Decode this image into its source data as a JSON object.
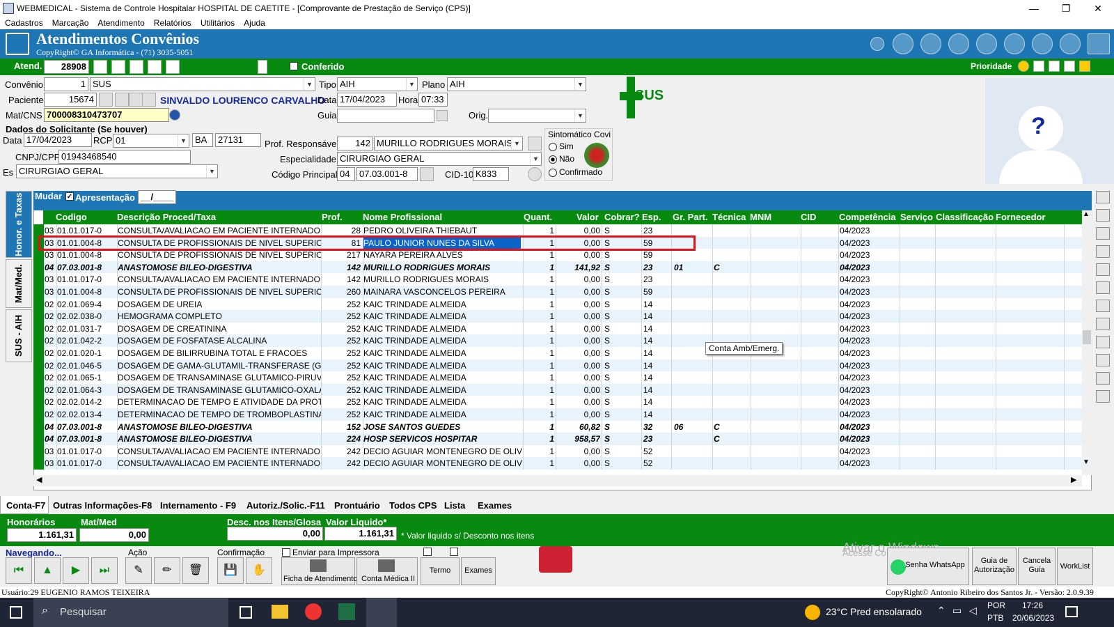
{
  "window": {
    "title": "WEBMEDICAL - Sistema de Controle Hospitalar HOSPITAL DE CAETITE - [Comprovante de Prestação de Serviço  (CPS)]",
    "min": "—",
    "max": "❐",
    "close": "✕"
  },
  "menu": [
    "Cadastros",
    "Marcação",
    "Atendimento",
    "Relatórios",
    "Utilitários",
    "Ajuda"
  ],
  "header": {
    "title": "Atendimentos Convênios",
    "subtitle": "CopyRight© GA Informática - (71) 3035-5051"
  },
  "atend": {
    "label": "Atend.",
    "value": "28908",
    "conferido": "Conferido",
    "prioridade": "Prioridade"
  },
  "form": {
    "convenio_label": "Convênio",
    "convenio_code": "1",
    "convenio_name": "SUS",
    "tipo_label": "Tipo",
    "tipo": "AIH",
    "plano_label": "Plano",
    "plano": "AIH",
    "paciente_label": "Paciente",
    "paciente_code": "15674",
    "paciente_name": "SINVALDO LOURENCO CARVALHO",
    "data_label": "Data",
    "data": "17/04/2023",
    "hora_label": "Hora",
    "hora": "07:33",
    "matcns_label": "Mat/CNS",
    "matcns": "700008310473707",
    "guia_label": "Guia",
    "guia": "",
    "orig_label": "Orig.",
    "orig": "",
    "solicitante_title": "Dados do Solicitante (Se houver)",
    "sol_data_label": "Data",
    "sol_data": "17/04/2023",
    "rcp_label": "RCP",
    "rcp": "01",
    "uf": "BA",
    "crm": "27131",
    "cnpj_label": "CNPJ/CPF",
    "cnpj": "01943468540",
    "es_label": "Es",
    "es": "CIRURGIAO GERAL",
    "prof_label": "Prof. Responsável",
    "prof_code": "142",
    "prof_name": "MURILLO RODRIGUES MORAIS",
    "esp_label": "Especialidade",
    "esp": "CIRURGIAO GERAL",
    "codprinc_label": "Código Principal",
    "codprinc_grp": "04",
    "codprinc": "07.03.001-8",
    "cid_label": "CID-10",
    "cid": "K833",
    "covid_title": "Sintomático Covi",
    "covid_sim": "Sim",
    "covid_nao": "Não",
    "covid_conf": "Confirmado"
  },
  "sus_logo": "SUS",
  "sidetabs": [
    "Honor. e Taxas",
    "Mat/Med.",
    "SUS - AIH"
  ],
  "grid": {
    "mudar": "Mudar",
    "apresentacao": "Apresentação",
    "apres_value": "__/____",
    "columns": [
      "Codigo",
      "Descrição Proced/Taxa",
      "Prof.",
      "Nome Profissional",
      "Quant.",
      "Valor",
      "Cobrar?",
      "Esp.",
      "Gr. Part.",
      "Técnica",
      "MNM",
      "CID",
      "Competência",
      "Serviço",
      "Classificação",
      "Fornecedor"
    ],
    "rows": [
      {
        "g": "03",
        "cod": "01.01.017-0",
        "desc": "CONSULTA/AVALIACAO EM PACIENTE INTERNADO",
        "prof": "28",
        "nome": "PEDRO OLIVEIRA THIEBAUT",
        "q": "1",
        "val": "0,00",
        "cob": "S",
        "esp": "23",
        "gr": "",
        "tec": "",
        "comp": "04/2023",
        "b": false
      },
      {
        "g": "03",
        "cod": "01.01.004-8",
        "desc": "CONSULTA DE PROFISSIONAIS DE NIVEL SUPERIOR",
        "prof": "81",
        "nome": "PAULO JUNIOR NUNES DA SILVA",
        "q": "1",
        "val": "0,00",
        "cob": "S",
        "esp": "59",
        "gr": "",
        "tec": "",
        "comp": "04/2023",
        "b": false,
        "sel": true
      },
      {
        "g": "03",
        "cod": "01.01.004-8",
        "desc": "CONSULTA DE PROFISSIONAIS DE NIVEL SUPERIOR",
        "prof": "217",
        "nome": "NAYARA PEREIRA ALVES",
        "q": "1",
        "val": "0,00",
        "cob": "S",
        "esp": "59",
        "gr": "",
        "tec": "",
        "comp": "04/2023",
        "b": false
      },
      {
        "g": "04",
        "cod": "07.03.001-8",
        "desc": "ANASTOMOSE BILEO-DIGESTIVA",
        "prof": "142",
        "nome": "MURILLO RODRIGUES MORAIS",
        "q": "1",
        "val": "141,92",
        "cob": "S",
        "esp": "23",
        "gr": "01",
        "tec": "C",
        "comp": "04/2023",
        "b": true
      },
      {
        "g": "03",
        "cod": "01.01.017-0",
        "desc": "CONSULTA/AVALIACAO EM PACIENTE INTERNADO",
        "prof": "142",
        "nome": "MURILLO RODRIGUES MORAIS",
        "q": "1",
        "val": "0,00",
        "cob": "S",
        "esp": "23",
        "gr": "",
        "tec": "",
        "comp": "04/2023",
        "b": false
      },
      {
        "g": "03",
        "cod": "01.01.004-8",
        "desc": "CONSULTA DE PROFISSIONAIS DE NIVEL SUPERIOR",
        "prof": "260",
        "nome": "MAINARA VASCONCELOS PEREIRA",
        "q": "1",
        "val": "0,00",
        "cob": "S",
        "esp": "59",
        "gr": "",
        "tec": "",
        "comp": "04/2023",
        "b": false
      },
      {
        "g": "02",
        "cod": "02.01.069-4",
        "desc": "DOSAGEM DE UREIA",
        "prof": "252",
        "nome": "KAIC TRINDADE ALMEIDA",
        "q": "1",
        "val": "0,00",
        "cob": "S",
        "esp": "14",
        "gr": "",
        "tec": "",
        "comp": "04/2023",
        "b": false
      },
      {
        "g": "02",
        "cod": "02.02.038-0",
        "desc": "HEMOGRAMA COMPLETO",
        "prof": "252",
        "nome": "KAIC TRINDADE ALMEIDA",
        "q": "1",
        "val": "0,00",
        "cob": "S",
        "esp": "14",
        "gr": "",
        "tec": "",
        "comp": "04/2023",
        "b": false
      },
      {
        "g": "02",
        "cod": "02.01.031-7",
        "desc": "DOSAGEM DE CREATININA",
        "prof": "252",
        "nome": "KAIC TRINDADE ALMEIDA",
        "q": "1",
        "val": "0,00",
        "cob": "S",
        "esp": "14",
        "gr": "",
        "tec": "",
        "comp": "04/2023",
        "b": false
      },
      {
        "g": "02",
        "cod": "02.01.042-2",
        "desc": "DOSAGEM DE FOSFATASE ALCALINA",
        "prof": "252",
        "nome": "KAIC TRINDADE ALMEIDA",
        "q": "1",
        "val": "0,00",
        "cob": "S",
        "esp": "14",
        "gr": "",
        "tec": "",
        "comp": "04/2023",
        "b": false
      },
      {
        "g": "02",
        "cod": "02.01.020-1",
        "desc": "DOSAGEM DE BILIRRUBINA TOTAL E FRACOES",
        "prof": "252",
        "nome": "KAIC TRINDADE ALMEIDA",
        "q": "1",
        "val": "0,00",
        "cob": "S",
        "esp": "14",
        "gr": "",
        "tec": "",
        "comp": "04/2023",
        "b": false
      },
      {
        "g": "02",
        "cod": "02.01.046-5",
        "desc": "DOSAGEM DE GAMA-GLUTAMIL-TRANSFERASE (GAM",
        "prof": "252",
        "nome": "KAIC TRINDADE ALMEIDA",
        "q": "1",
        "val": "0,00",
        "cob": "S",
        "esp": "14",
        "gr": "",
        "tec": "",
        "comp": "04/2023",
        "b": false
      },
      {
        "g": "02",
        "cod": "02.01.065-1",
        "desc": "DOSAGEM DE TRANSAMINASE GLUTAMICO-PIRUVIC",
        "prof": "252",
        "nome": "KAIC TRINDADE ALMEIDA",
        "q": "1",
        "val": "0,00",
        "cob": "S",
        "esp": "14",
        "gr": "",
        "tec": "",
        "comp": "04/2023",
        "b": false
      },
      {
        "g": "02",
        "cod": "02.01.064-3",
        "desc": "DOSAGEM DE TRANSAMINASE GLUTAMICO-OXALACI",
        "prof": "252",
        "nome": "KAIC TRINDADE ALMEIDA",
        "q": "1",
        "val": "0,00",
        "cob": "S",
        "esp": "14",
        "gr": "",
        "tec": "",
        "comp": "04/2023",
        "b": false
      },
      {
        "g": "02",
        "cod": "02.02.014-2",
        "desc": "DETERMINACAO DE TEMPO E ATIVIDADE DA PROTR",
        "prof": "252",
        "nome": "KAIC TRINDADE ALMEIDA",
        "q": "1",
        "val": "0,00",
        "cob": "S",
        "esp": "14",
        "gr": "",
        "tec": "",
        "comp": "04/2023",
        "b": false
      },
      {
        "g": "02",
        "cod": "02.02.013-4",
        "desc": "DETERMINACAO DE TEMPO DE TROMBOPLASTINA F",
        "prof": "252",
        "nome": "KAIC TRINDADE ALMEIDA",
        "q": "1",
        "val": "0,00",
        "cob": "S",
        "esp": "14",
        "gr": "",
        "tec": "",
        "comp": "04/2023",
        "b": false
      },
      {
        "g": "04",
        "cod": "07.03.001-8",
        "desc": "ANASTOMOSE BILEO-DIGESTIVA",
        "prof": "152",
        "nome": "JOSE SANTOS GUEDES",
        "q": "1",
        "val": "60,82",
        "cob": "S",
        "esp": "32",
        "gr": "06",
        "tec": "C",
        "comp": "04/2023",
        "b": true
      },
      {
        "g": "04",
        "cod": "07.03.001-8",
        "desc": "ANASTOMOSE BILEO-DIGESTIVA",
        "prof": "224",
        "nome": "HOSP SERVICOS HOSPITAR",
        "q": "1",
        "val": "958,57",
        "cob": "S",
        "esp": "23",
        "gr": "",
        "tec": "C",
        "comp": "04/2023",
        "b": true
      },
      {
        "g": "03",
        "cod": "01.01.017-0",
        "desc": "CONSULTA/AVALIACAO EM PACIENTE INTERNADO",
        "prof": "242",
        "nome": "DECIO AGUIAR MONTENEGRO DE OLIVE",
        "q": "1",
        "val": "0,00",
        "cob": "S",
        "esp": "52",
        "gr": "",
        "tec": "",
        "comp": "04/2023",
        "b": false
      },
      {
        "g": "03",
        "cod": "01.01.017-0",
        "desc": "CONSULTA/AVALIACAO EM PACIENTE INTERNADO",
        "prof": "242",
        "nome": "DECIO AGUIAR MONTENEGRO DE OLIVE",
        "q": "1",
        "val": "0,00",
        "cob": "S",
        "esp": "52",
        "gr": "",
        "tec": "",
        "comp": "04/2023",
        "b": false
      }
    ]
  },
  "tooltip": "Conta Amb/Emerg.",
  "tabs": [
    "Conta-F7",
    "Outras Informações-F8",
    "Internamento - F9",
    "Autoriz./Solic.-F11",
    "Prontuário",
    "Todos CPS",
    "Lista",
    "Exames"
  ],
  "totals": {
    "hon_label": "Honorários",
    "hon": "1.161,31",
    "mat_label": "Mat/Med",
    "mat": "0,00",
    "desc_label": "Desc. nos Itens/Glosa",
    "desc": "0,00",
    "liq_label": "Valor Liquido*",
    "liq": "1.161,31",
    "note": "* Valor liquido s/ Desconto nos itens"
  },
  "nav": {
    "navegando": "Navegando...",
    "acao": "Ação",
    "confirmacao": "Confirmação",
    "enviar": "Enviar para Impressora",
    "ficha": "Ficha de Atendimento",
    "conta_medica": "Conta Médica II",
    "termo": "Termo",
    "exames": "Exames",
    "whatsapp": "Senha WhatsApp",
    "guia_aut": "Guia de Autorização",
    "cancela": "Cancela Guia",
    "worklist": "WorkList",
    "activate1": "Ativar o Windows",
    "activate2": "Acesse Co"
  },
  "status": {
    "user": "Usuário:29 EUGENIO RAMOS TEIXEIRA",
    "copyright": "CopyRight© Antonio Ribeiro dos Santos Jr. - Versão: 2.0.9.39"
  },
  "taskbar": {
    "search": "Pesquisar",
    "weather": "23°C  Pred ensolarado",
    "lang1": "POR",
    "lang2": "PTB",
    "time": "17:26",
    "date": "20/06/2023"
  },
  "colors": {
    "green": "#078a0f",
    "blue": "#1e76b4",
    "select": "#0a64c8",
    "red": "#e0131a"
  }
}
